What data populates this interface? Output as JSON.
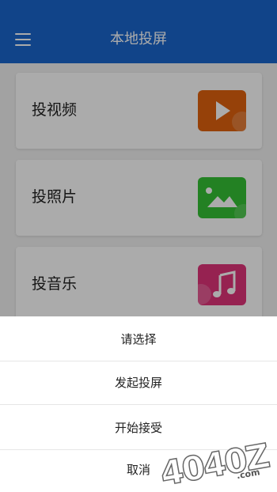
{
  "header": {
    "title": "本地投屏"
  },
  "cards": [
    {
      "label": "投视频",
      "icon": "tv-play-icon",
      "color": "#e0620e"
    },
    {
      "label": "投照片",
      "icon": "landscape-image-icon",
      "color": "#35c135"
    },
    {
      "label": "投音乐",
      "icon": "music-note-icon",
      "color": "#e0337a"
    }
  ],
  "sheet": {
    "title": "请选择",
    "options": [
      "发起投屏",
      "开始接受"
    ],
    "cancel": "取消"
  },
  "watermark": {
    "text": "4040Z.com"
  }
}
